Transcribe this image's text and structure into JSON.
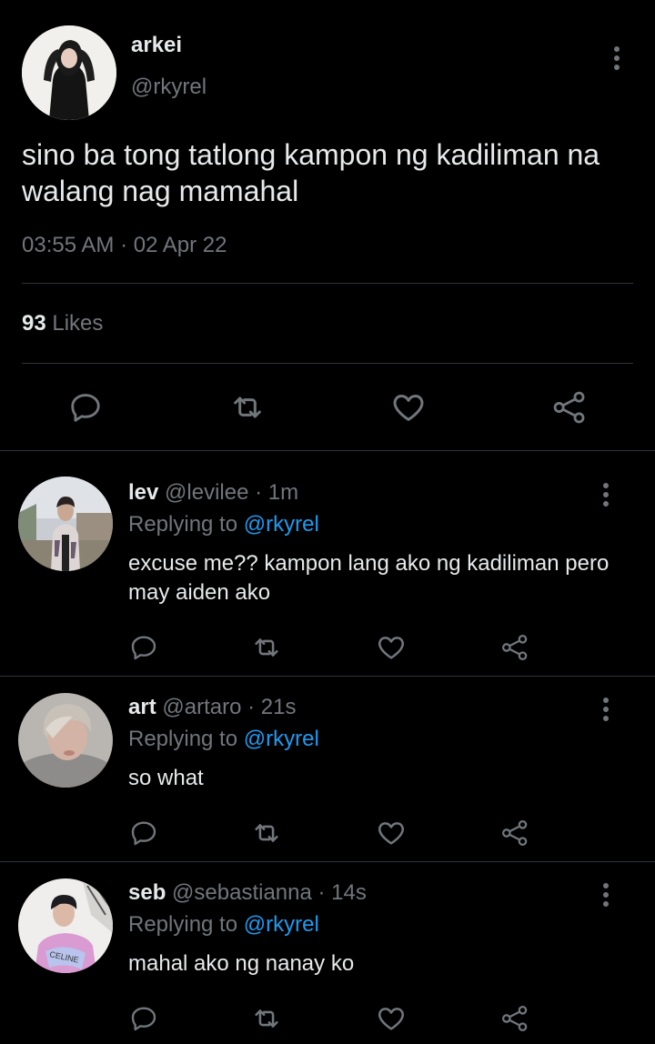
{
  "tweet": {
    "author_name": "arkei",
    "author_handle": "@rkyrel",
    "text": "sino ba tong tatlong kampon ng kadiliman na walang nag mamahal",
    "timestamp": "03:55 AM · 02 Apr 22",
    "likes_count": "93",
    "likes_label": "Likes",
    "actions": [
      "reply-icon",
      "retweet-icon",
      "like-icon",
      "share-icon"
    ]
  },
  "replies": [
    {
      "name": "lev",
      "handle": "@levilee",
      "time": "· 1m",
      "replying_to_label": "Replying to",
      "replying_to_handle": "@rkyrel",
      "text": "excuse me?? kampon lang ako ng kadiliman pero may aiden ako"
    },
    {
      "name": "art",
      "handle": "@artaro",
      "time": "· 21s",
      "replying_to_label": "Replying to",
      "replying_to_handle": "@rkyrel",
      "text": "so what"
    },
    {
      "name": "seb",
      "handle": "@sebastianna",
      "time": "· 14s",
      "replying_to_label": "Replying to",
      "replying_to_handle": "@rkyrel",
      "text": "mahal ako ng nanay ko",
      "avatar_shirt_text": "CELINE"
    }
  ],
  "colors": {
    "background": "#000000",
    "text": "#e7e9ea",
    "secondary": "#71767b",
    "link": "#1d9bf0",
    "divider": "#2f3336"
  }
}
